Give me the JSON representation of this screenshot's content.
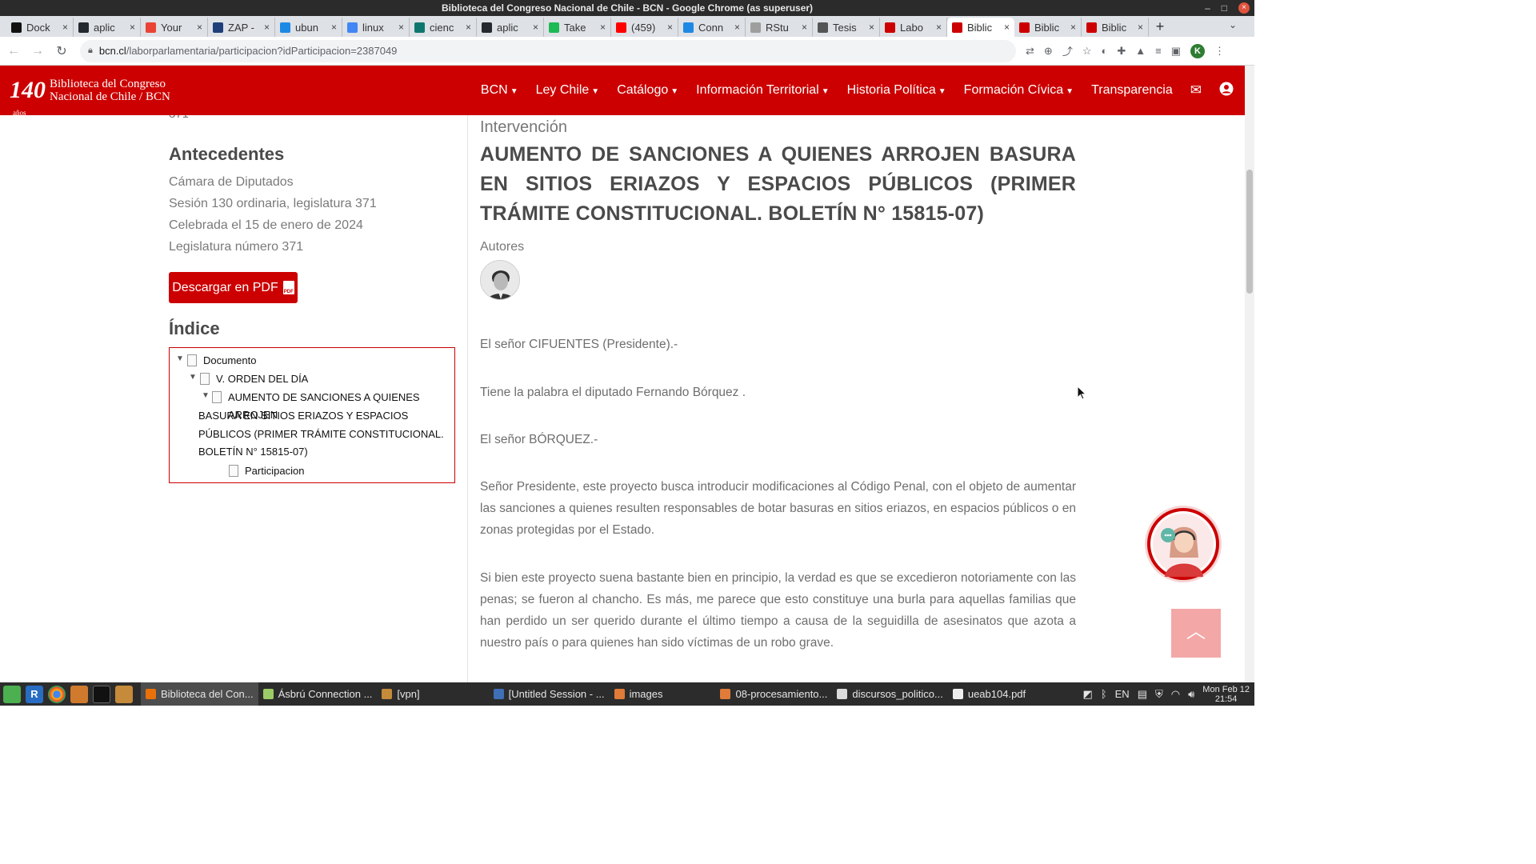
{
  "window": {
    "title": "Biblioteca del Congreso Nacional de Chile - BCN - Google Chrome (as superuser)",
    "controls": [
      "–",
      "□",
      "×"
    ]
  },
  "tabs": [
    {
      "label": "Dock",
      "favicon_color": "#111111"
    },
    {
      "label": "aplic",
      "favicon_color": "#24292f"
    },
    {
      "label": "Your",
      "favicon_color": "#ea4335"
    },
    {
      "label": "ZAP -",
      "favicon_color": "#1f3f7a"
    },
    {
      "label": "ubun",
      "favicon_color": "#1e88e5"
    },
    {
      "label": "linux",
      "favicon_color": "#4285f4"
    },
    {
      "label": "cienc",
      "favicon_color": "#0f766e"
    },
    {
      "label": "aplic",
      "favicon_color": "#24292f"
    },
    {
      "label": "Take",
      "favicon_color": "#1db954"
    },
    {
      "label": "(459)",
      "favicon_color": "#ff0000"
    },
    {
      "label": "Conn",
      "favicon_color": "#1e88e5"
    },
    {
      "label": "RStu",
      "favicon_color": "#9e9e9e"
    },
    {
      "label": "Tesis",
      "favicon_color": "#555555"
    },
    {
      "label": "Labo",
      "favicon_color": "#cc0000"
    },
    {
      "label": "Biblic",
      "favicon_color": "#cc0000",
      "active": true
    },
    {
      "label": "Biblic",
      "favicon_color": "#cc0000"
    },
    {
      "label": "Biblic",
      "favicon_color": "#cc0000"
    }
  ],
  "tab_close": "×",
  "new_tab": "+",
  "tab_menu": "⌄",
  "address": {
    "host": "bcn.cl",
    "path": "/laborparlamentaria/participacion?idParticipacion=2387049"
  },
  "profile_initial": "K",
  "site": {
    "logo_number": "140",
    "logo_sub": "años",
    "logo_line1": "Biblioteca del Congreso",
    "logo_line2": "Nacional de Chile / BCN",
    "nav": [
      {
        "label": "BCN",
        "dropdown": true
      },
      {
        "label": "Ley Chile",
        "dropdown": true
      },
      {
        "label": "Catálogo",
        "dropdown": true
      },
      {
        "label": "Información Territorial",
        "dropdown": true
      },
      {
        "label": "Historia Política",
        "dropdown": true
      },
      {
        "label": "Formación Cívica",
        "dropdown": true
      },
      {
        "label": "Transparencia",
        "dropdown": false
      }
    ],
    "mail_icon": "✉",
    "user_icon": "●"
  },
  "left": {
    "cutoff_text": "371",
    "antecedentes_heading": "Antecedentes",
    "antecedentes": [
      "Cámara de Diputados",
      "Sesión 130 ordinaria, legislatura 371",
      "Celebrada el 15 de enero de 2024",
      "Legislatura número 371"
    ],
    "pdf_button": "Descargar en PDF",
    "pdf_icon_text": "PDF",
    "indice_heading": "Índice",
    "tree": {
      "root": "Documento",
      "level1": "V. ORDEN DEL DÍA",
      "level2_line1": "AUMENTO DE SANCIONES A QUIENES ARROJEN",
      "level2_rest": "BASURA EN SITIOS ERIAZOS Y ESPACIOS PÚBLICOS (PRIMER TRÁMITE CONSTITUCIONAL. BOLETÍN N° 15815-07)",
      "level3": "Participacion"
    }
  },
  "right": {
    "intervencion_label": "Intervención",
    "title": "AUMENTO DE SANCIONES A QUIENES ARROJEN BASURA EN SITIOS ERIAZOS Y ESPACIOS PÚBLICOS (PRIMER TRÁMITE CONSTITUCIONAL. BOLETÍN N° 15815-07)",
    "autores_label": "Autores",
    "paragraphs": [
      "El señor CIFUENTES (Presidente).-",
      "Tiene la palabra el diputado Fernando Bórquez .",
      "El señor BÓRQUEZ.-",
      "Señor Presidente, este proyecto busca introducir modificaciones al Código Penal, con el objeto de aumentar las sanciones a quienes resulten responsables de botar basuras en sitios eriazos, en espacios públicos o en zonas protegidas por el Estado.",
      "Si bien este proyecto suena bastante bien en principio, la verdad es que se excedieron notoriamente con las penas; se fueron al chancho. Es más, me parece que esto constituye una burla para aquellas familias que han perdido un ser querido durante el último tiempo a causa de la seguidilla de asesinatos que azota a nuestro país o para quienes han sido víctimas de un robo grave."
    ]
  },
  "scroll_top_icon": "︿",
  "taskbar": {
    "items": [
      {
        "label": "Biblioteca del Con...",
        "active": true,
        "icon_color": "#e8710a"
      },
      {
        "label": "Ásbrú Connection ...",
        "active": false,
        "icon_color": "#9ccc65"
      },
      {
        "label": "[vpn]",
        "active": false,
        "icon_color": "#c58b3a"
      },
      {
        "label": "[Untitled Session - ...",
        "active": false,
        "icon_color": "#3f6fb5"
      },
      {
        "label": "images",
        "active": false,
        "icon_color": "#e07b39"
      },
      {
        "label": "08-procesamiento...",
        "active": false,
        "icon_color": "#e07b39"
      },
      {
        "label": "discursos_politico...",
        "active": false,
        "icon_color": "#dcdcdc"
      },
      {
        "label": "ueab104.pdf",
        "active": false,
        "icon_color": "#eeeeee"
      }
    ],
    "lang": "EN",
    "clock_day": "Mon Feb 12",
    "clock_time": "21:54"
  },
  "colors": {
    "brand_red": "#cc0000",
    "text_gray": "#6e6e6e",
    "heading_gray": "#4a4a4a"
  }
}
